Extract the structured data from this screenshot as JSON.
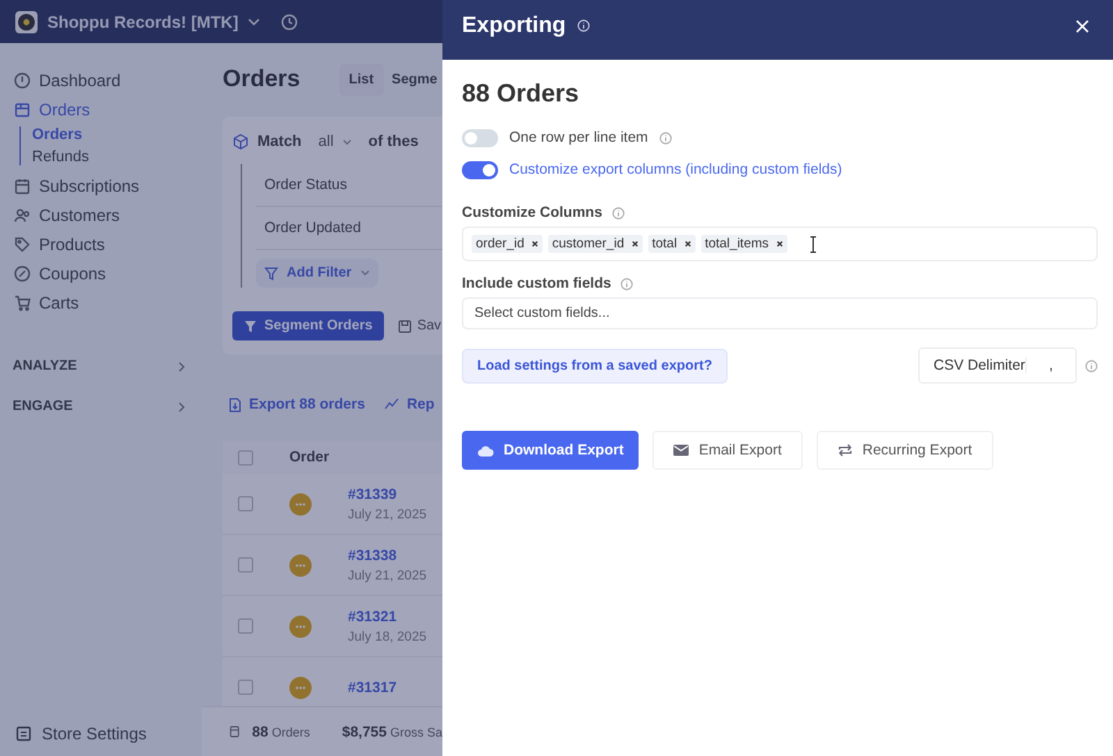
{
  "app_header": {
    "store_name": "Shoppu Records! [MTK]"
  },
  "sidebar": {
    "items": [
      {
        "label": "Dashboard",
        "selected": false
      },
      {
        "label": "Orders",
        "selected": true,
        "children": [
          {
            "label": "Orders",
            "selected": true
          },
          {
            "label": "Refunds",
            "selected": false
          }
        ]
      },
      {
        "label": "Subscriptions",
        "selected": false
      },
      {
        "label": "Customers",
        "selected": false
      },
      {
        "label": "Products",
        "selected": false
      },
      {
        "label": "Coupons",
        "selected": false
      },
      {
        "label": "Carts",
        "selected": false
      }
    ],
    "sections": [
      "ANALYZE",
      "ENGAGE"
    ],
    "footer_item": "Store Settings"
  },
  "main": {
    "title": "Orders",
    "view_tabs": [
      {
        "label": "List",
        "selected": true
      },
      {
        "label": "Segme",
        "selected": false
      }
    ],
    "filter": {
      "match_label": "Match",
      "match_value": "all",
      "match_suffix": "of thes",
      "conditions": [
        "Order Status",
        "Order Updated"
      ],
      "add_filter": "Add Filter",
      "segment_button": "Segment Orders",
      "save_button": "Sav"
    },
    "actions": [
      "Export 88 orders",
      "Rep"
    ],
    "table": {
      "column": "Order",
      "all_checked": false,
      "rows": [
        {
          "number": "#31339",
          "date": "July 21, 2025",
          "checked": false
        },
        {
          "number": "#31338",
          "date": "July 21, 2025",
          "checked": false
        },
        {
          "number": "#31321",
          "date": "July 18, 2025",
          "checked": false
        },
        {
          "number": "#31317",
          "checked": false
        }
      ]
    },
    "summary": [
      {
        "value": "88",
        "label": "Orders"
      },
      {
        "value": "$8,755",
        "label": "Gross Sa"
      }
    ]
  },
  "drawer": {
    "title": "Exporting",
    "heading": "88 Orders",
    "toggles": [
      {
        "label": "One row per line item",
        "on": false
      },
      {
        "label": "Customize export columns (including custom fields)",
        "on": true
      }
    ],
    "columns_label": "Customize Columns",
    "columns": [
      "order_id",
      "customer_id",
      "total",
      "total_items"
    ],
    "custom_fields_label": "Include custom fields",
    "custom_fields_placeholder": "Select custom fields...",
    "load_link": "Load settings from a saved export?",
    "delimiter_label": "CSV Delimiter",
    "delimiter_value": ",",
    "buttons": [
      {
        "label": "Download Export",
        "kind": "primary"
      },
      {
        "label": "Email Export",
        "kind": "secondary"
      },
      {
        "label": "Recurring Export",
        "kind": "secondary"
      }
    ]
  }
}
